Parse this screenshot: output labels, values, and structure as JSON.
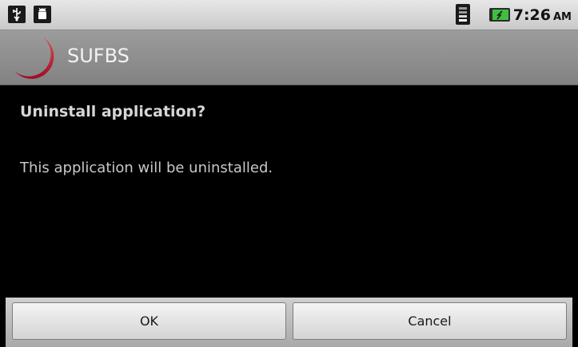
{
  "status_bar": {
    "icons": [
      "usb-icon",
      "android-debug-icon",
      "wifi-icon",
      "battery-icon"
    ],
    "time": "7:26",
    "ampm": "AM"
  },
  "app_header": {
    "title": "SUFBS",
    "logo_color": "#c8102e"
  },
  "dialog": {
    "title": "Uninstall application?",
    "message": "This application will be uninstalled."
  },
  "buttons": {
    "ok_label": "OK",
    "cancel_label": "Cancel"
  }
}
